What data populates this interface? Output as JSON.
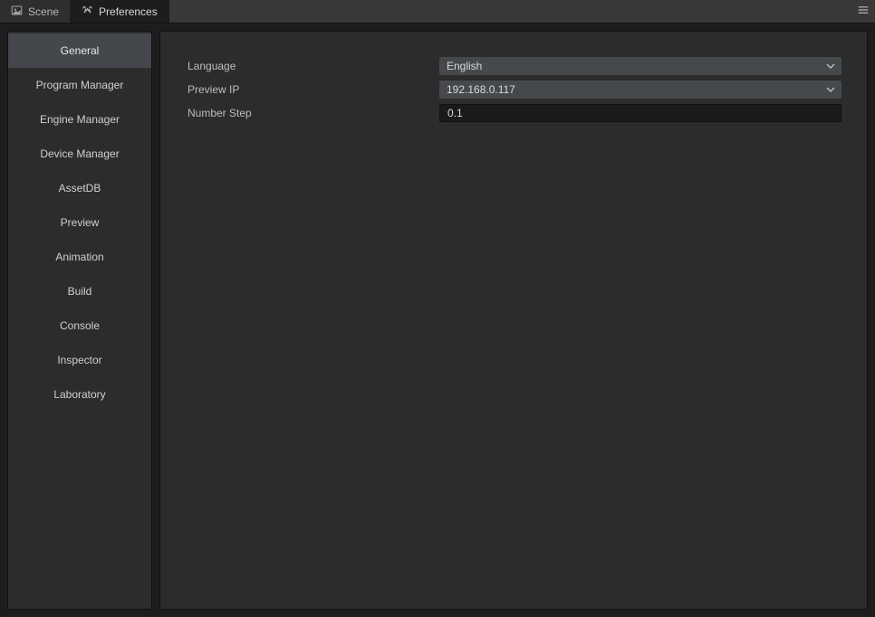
{
  "tabs": [
    {
      "label": "Scene",
      "active": false
    },
    {
      "label": "Preferences",
      "active": true
    }
  ],
  "sidebar": {
    "items": [
      {
        "label": "General",
        "selected": true
      },
      {
        "label": "Program Manager",
        "selected": false
      },
      {
        "label": "Engine Manager",
        "selected": false
      },
      {
        "label": "Device Manager",
        "selected": false
      },
      {
        "label": "AssetDB",
        "selected": false
      },
      {
        "label": "Preview",
        "selected": false
      },
      {
        "label": "Animation",
        "selected": false
      },
      {
        "label": "Build",
        "selected": false
      },
      {
        "label": "Console",
        "selected": false
      },
      {
        "label": "Inspector",
        "selected": false
      },
      {
        "label": "Laboratory",
        "selected": false
      }
    ]
  },
  "content": {
    "rows": {
      "language": {
        "label": "Language",
        "type": "select",
        "value": "English"
      },
      "preview_ip": {
        "label": "Preview IP",
        "type": "select",
        "value": "192.168.0.117"
      },
      "number_step": {
        "label": "Number Step",
        "type": "number",
        "value": "0.1"
      }
    }
  }
}
